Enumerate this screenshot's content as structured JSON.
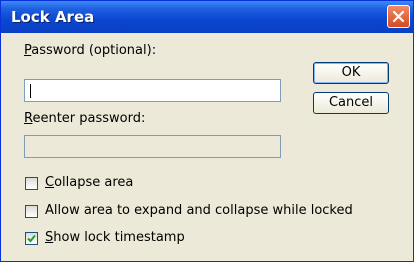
{
  "window": {
    "title": "Lock Area"
  },
  "fields": {
    "password_label": "Password (optional):",
    "password_value": "",
    "reenter_label": "Reenter password:",
    "reenter_value": ""
  },
  "buttons": {
    "ok": "OK",
    "cancel": "Cancel"
  },
  "checkboxes": [
    {
      "label": "Collapse area",
      "checked": false
    },
    {
      "label": "Allow area to expand and collapse while locked",
      "checked": false
    },
    {
      "label": "Show lock timestamp",
      "checked": true
    }
  ],
  "colors": {
    "title_bar": "#0a46d2",
    "close_button": "#d54b20",
    "dialog_bg": "#ece9d8"
  }
}
